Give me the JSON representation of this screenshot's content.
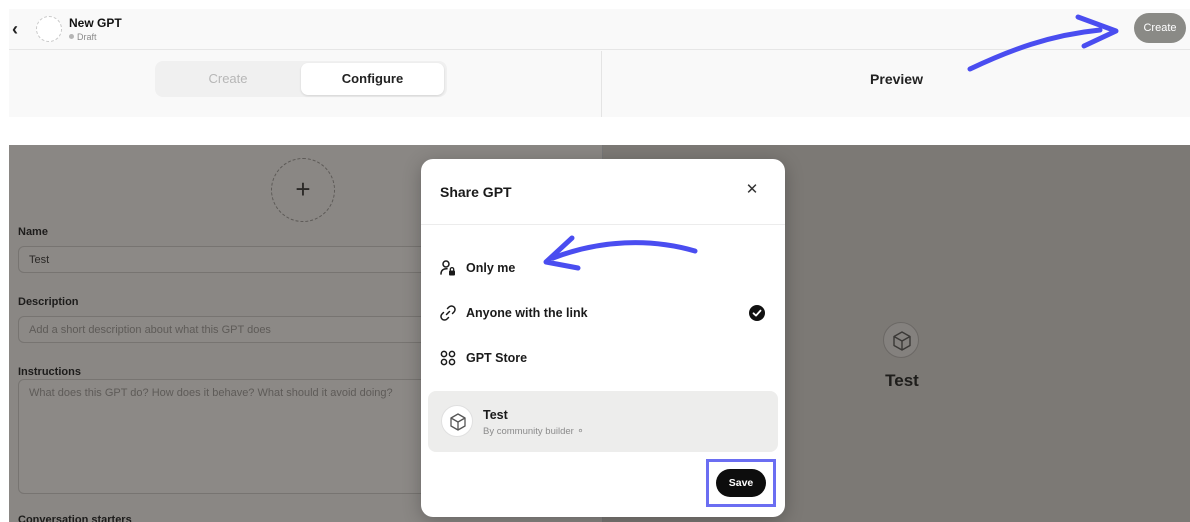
{
  "top_editor": {
    "gpt_name": "New GPT",
    "gpt_status": "Draft",
    "create_button": "Create",
    "tabs": {
      "create": "Create",
      "configure": "Configure",
      "active": "Configure"
    },
    "preview_title": "Preview"
  },
  "bottom_editor": {
    "fields": {
      "name_label": "Name",
      "name_value": "Test",
      "description_label": "Description",
      "description_placeholder": "Add a short description about what this GPT does",
      "instructions_label": "Instructions",
      "instructions_placeholder": "What does this GPT do? How does it behave? What should it avoid doing?",
      "conversation_starters_label": "Conversation starters"
    },
    "preview": {
      "gpt_name": "Test"
    }
  },
  "share_modal": {
    "title": "Share GPT",
    "options": [
      {
        "label": "Only me",
        "icon": "person-lock-icon",
        "selected": false
      },
      {
        "label": "Anyone with the link",
        "icon": "link-icon",
        "selected": true
      },
      {
        "label": "GPT Store",
        "icon": "grid-icon",
        "selected": false
      }
    ],
    "card": {
      "name": "Test",
      "subtitle": "By community builder"
    },
    "save_button": "Save"
  },
  "colors": {
    "annotation_arrow": "#4a4df0",
    "highlight_border": "#6b6ef2",
    "overlay": "#8a8784"
  }
}
